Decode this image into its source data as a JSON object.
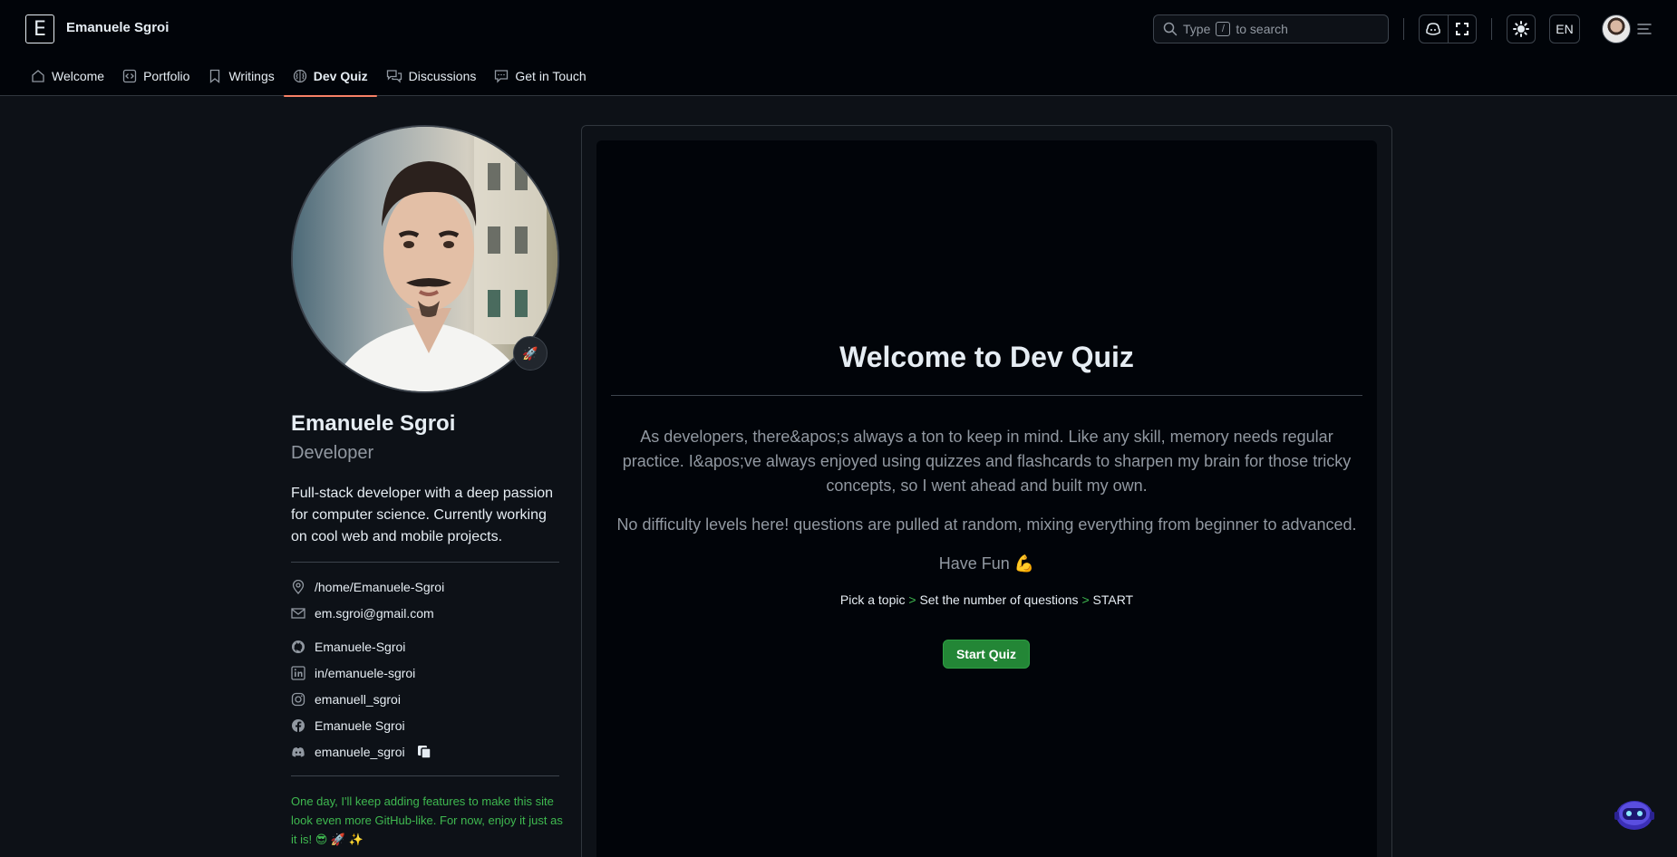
{
  "header": {
    "logo_letter": "E",
    "site_title": "Emanuele Sgroi",
    "search": {
      "label_before": "Type",
      "key": "/",
      "label_after": "to search"
    },
    "language": "EN"
  },
  "nav": {
    "items": [
      {
        "label": "Welcome",
        "icon": "home-icon"
      },
      {
        "label": "Portfolio",
        "icon": "code-square-icon"
      },
      {
        "label": "Writings",
        "icon": "bookmark-icon"
      },
      {
        "label": "Dev Quiz",
        "icon": "brain-icon",
        "active": true
      },
      {
        "label": "Discussions",
        "icon": "comment-discussion-icon"
      },
      {
        "label": "Get in Touch",
        "icon": "comment-icon"
      }
    ]
  },
  "profile": {
    "name": "Emanuele Sgroi",
    "role": "Developer",
    "bio": "Full-stack developer with a deep passion for computer science. Currently working on cool web and mobile projects.",
    "status_emoji": "🚀",
    "location": "/home/Emanuele-Sgroi",
    "email": "em.sgroi@gmail.com",
    "github": "Emanuele-Sgroi",
    "linkedin": "in/emanuele-sgroi",
    "instagram": "emanuell_sgroi",
    "facebook": "Emanuele Sgroi",
    "discord": "emanuele_sgroi",
    "footnote": "One day, I'll keep adding features to make this site look even more GitHub-like. For now, enjoy it just as it is! 😎 🚀 ✨"
  },
  "quiz": {
    "title": "Welcome to Dev Quiz",
    "intro": "As developers, there&apos;s always a ton to keep in mind. Like any skill, memory needs regular practice. I&apos;ve always enjoyed using quizzes and flashcards to sharpen my brain for those tricky concepts, so I went ahead and built my own.",
    "difficulty": "No difficulty levels here! questions are pulled at random, mixing everything from beginner to advanced.",
    "fun": "Have Fun 💪",
    "steps": {
      "step1": "Pick a topic",
      "step2": "Set the number of questions",
      "step3": "START",
      "sep": ">"
    },
    "start_button": "Start Quiz"
  },
  "colors": {
    "background": "#0d1117",
    "header_bg": "#010409",
    "accent_underline": "#f78166",
    "primary_button": "#238636",
    "success_text": "#3fb950",
    "muted_text": "#9198a1"
  }
}
